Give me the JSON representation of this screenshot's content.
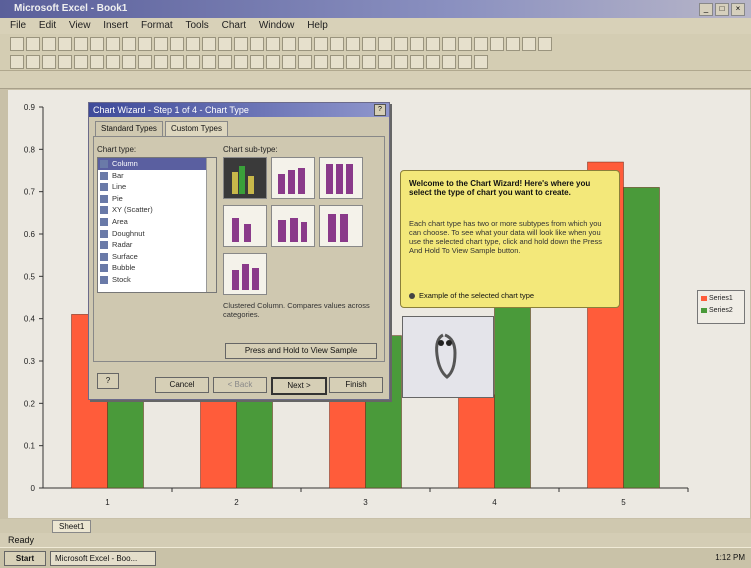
{
  "window": {
    "title": "Microsoft Excel - Book1"
  },
  "menu": [
    "File",
    "Edit",
    "View",
    "Insert",
    "Format",
    "Tools",
    "Chart",
    "Window",
    "Help"
  ],
  "dialog": {
    "title": "Chart Wizard - Step 1 of 4 - Chart Type",
    "tabs": [
      "Standard Types",
      "Custom Types"
    ],
    "chart_type_label": "Chart type:",
    "chart_types": [
      "Column",
      "Bar",
      "Line",
      "Pie",
      "XY (Scatter)",
      "Area",
      "Doughnut",
      "Radar",
      "Surface",
      "Bubble",
      "Stock"
    ],
    "selected_type": "Column",
    "subtype_label": "Chart sub-type:",
    "description": "Clustered Column. Compares values across categories.",
    "press_hold_label": "Press and Hold to View Sample",
    "buttons": {
      "help": "?",
      "cancel": "Cancel",
      "back": "< Back",
      "next": "Next >",
      "finish": "Finish"
    }
  },
  "help_bubble": {
    "heading": "Welcome to the Chart Wizard! Here's where you select the type of chart you want to create.",
    "body": "Each chart type has two or more subtypes from which you can choose. To see what your data will look like when you use the selected chart type, click and hold down the Press And Hold To View Sample button.",
    "option": "Example of the selected chart type"
  },
  "status": {
    "text": "Ready"
  },
  "sheet_tab": "Sheet1",
  "taskbar": {
    "start": "Start",
    "app": "Microsoft Excel - Boo...",
    "clock": "1:12 PM"
  },
  "colors": {
    "series1": "#ff5c3a",
    "series2": "#4a9a3a"
  },
  "chart_data": {
    "type": "bar",
    "categories": [
      "1",
      "2",
      "3",
      "4",
      "5"
    ],
    "series": [
      {
        "name": "Series1",
        "values": [
          0.41,
          0.28,
          0.32,
          0.22,
          0.77
        ]
      },
      {
        "name": "Series2",
        "values": [
          0.36,
          0.35,
          0.36,
          0.62,
          0.71
        ]
      }
    ],
    "ylim": [
      0,
      0.9
    ],
    "yticks": [
      "0",
      "0.1",
      "0.2",
      "0.3",
      "0.4",
      "0.5",
      "0.6",
      "0.7",
      "0.8",
      "0.9"
    ],
    "legend": "right",
    "grid": false
  }
}
